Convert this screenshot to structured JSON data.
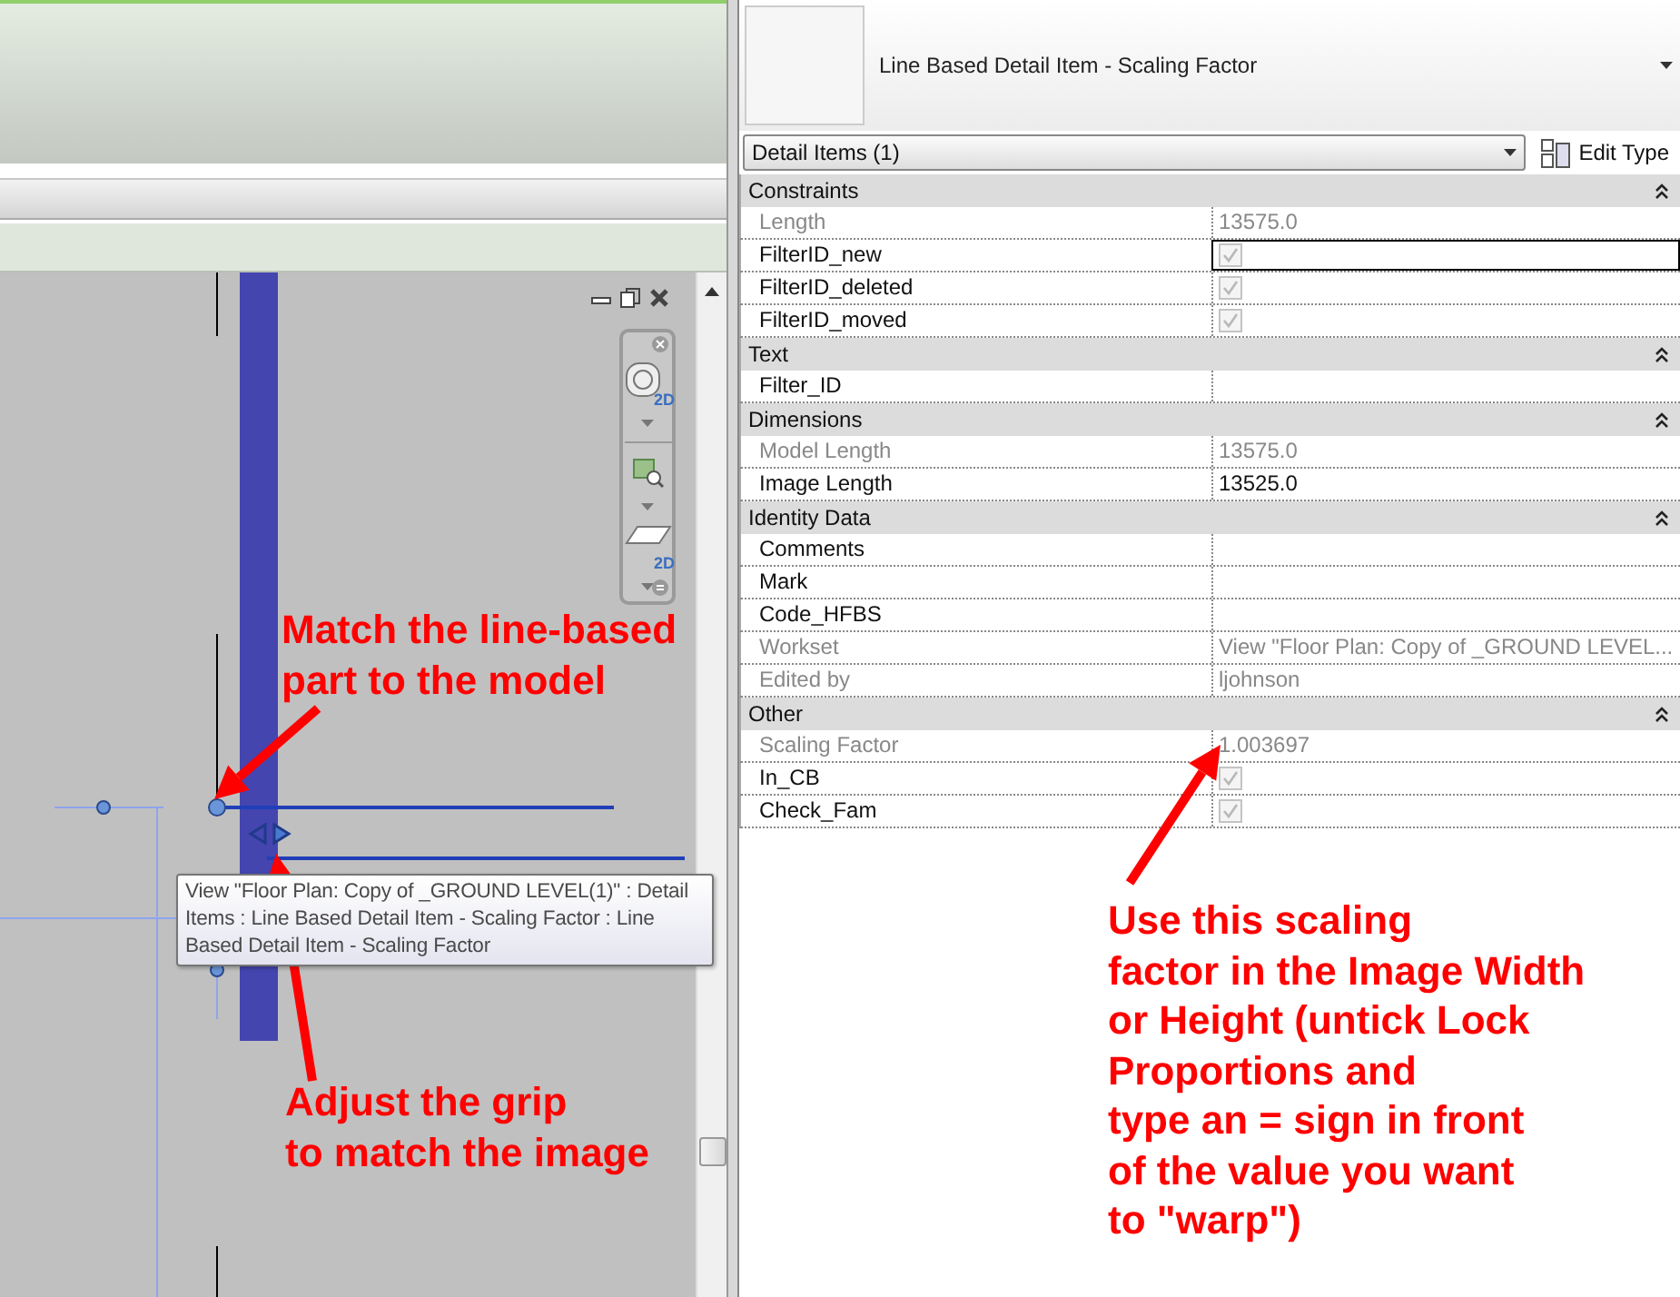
{
  "view": {
    "tooltip": "View \"Floor Plan: Copy of _GROUND LEVEL(1)\" : Detail Items : Line Based Detail Item - Scaling Factor : Line Based Detail Item - Scaling Factor",
    "nav_bar_labels": [
      "2D",
      "2D"
    ]
  },
  "properties_panel": {
    "type_name": "Line Based Detail Item - Scaling Factor",
    "instance_selector": "Detail Items (1)",
    "edit_type_button": "Edit Type",
    "groups": [
      {
        "title": "Constraints",
        "expanded": true,
        "rows": [
          {
            "label": "Length",
            "kind": "text",
            "value": "13575.0",
            "disabled": true,
            "selected": false
          },
          {
            "label": "FilterID_new",
            "kind": "check",
            "checked": true,
            "disabled": true,
            "selected": true
          },
          {
            "label": "FilterID_deleted",
            "kind": "check",
            "checked": true,
            "disabled": true,
            "selected": false
          },
          {
            "label": "FilterID_moved",
            "kind": "check",
            "checked": true,
            "disabled": true,
            "selected": false
          }
        ]
      },
      {
        "title": "Text",
        "expanded": true,
        "rows": [
          {
            "label": "Filter_ID",
            "kind": "text",
            "disabled": false,
            "selected": false
          }
        ]
      },
      {
        "title": "Dimensions",
        "expanded": true,
        "rows": [
          {
            "label": "Model Length",
            "kind": "text",
            "value": "13575.0",
            "disabled": true,
            "selected": false
          },
          {
            "label": "Image Length",
            "kind": "text",
            "value": "13525.0",
            "disabled": false,
            "selected": false
          }
        ]
      },
      {
        "title": "Identity Data",
        "expanded": true,
        "rows": [
          {
            "label": "Comments",
            "kind": "text",
            "disabled": false,
            "selected": false
          },
          {
            "label": "Mark",
            "kind": "text",
            "disabled": false,
            "selected": false
          },
          {
            "label": "Code_HFBS",
            "kind": "text",
            "disabled": false,
            "selected": false
          },
          {
            "label": "Workset",
            "kind": "text",
            "value": "View \"Floor Plan: Copy of _GROUND LEVEL...",
            "disabled": true,
            "selected": false
          },
          {
            "label": "Edited by",
            "kind": "text",
            "value": "ljohnson",
            "disabled": true,
            "selected": false
          }
        ]
      },
      {
        "title": "Other",
        "expanded": true,
        "rows": [
          {
            "label": "Scaling Factor",
            "kind": "text",
            "value": "1.003697",
            "disabled": true,
            "selected": false
          },
          {
            "label": "In_CB",
            "kind": "check",
            "checked": true,
            "disabled": true,
            "selected": false
          },
          {
            "label": "Check_Fam",
            "kind": "check",
            "checked": true,
            "disabled": true,
            "selected": false
          }
        ]
      }
    ]
  },
  "annotations": [
    {
      "lines": [
        "Match the line-based",
        "part to the model"
      ]
    },
    {
      "lines": [
        "Adjust the grip",
        "to match the image"
      ]
    },
    {
      "lines": [
        "Use this scaling",
        "factor in the Image Width",
        "or Height (untick Lock",
        "Proportions and",
        "type an = sign in front",
        "of the value you want",
        "to \"warp\")"
      ]
    }
  ]
}
